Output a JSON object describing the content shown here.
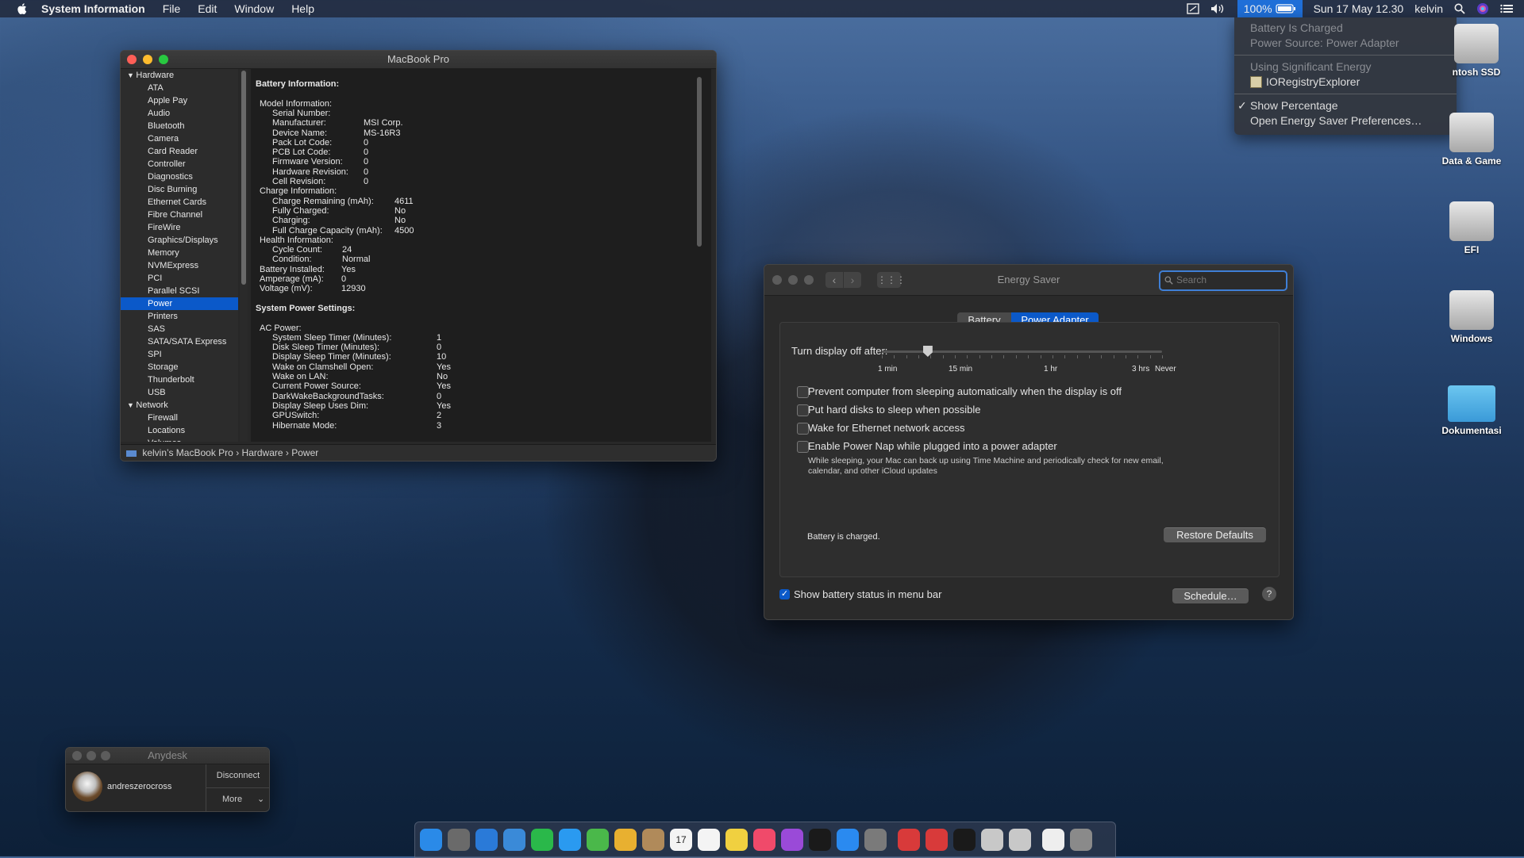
{
  "menubar": {
    "app_name": "System Information",
    "menus": [
      "File",
      "Edit",
      "Window",
      "Help"
    ],
    "battery_percent": "100%",
    "datetime": "Sun 17 May  12.30",
    "user": "kelvin"
  },
  "battery_menu": {
    "charged": "Battery Is Charged",
    "source": "Power Source: Power Adapter",
    "sig_header": "Using Significant Energy",
    "sig_app": "IORegistryExplorer",
    "show_pct": "Show Percentage",
    "open_prefs": "Open Energy Saver Preferences…"
  },
  "sysinfo": {
    "title": "MacBook Pro",
    "sidebar": [
      {
        "label": "Hardware",
        "group": true
      },
      {
        "label": "ATA"
      },
      {
        "label": "Apple Pay"
      },
      {
        "label": "Audio"
      },
      {
        "label": "Bluetooth"
      },
      {
        "label": "Camera"
      },
      {
        "label": "Card Reader"
      },
      {
        "label": "Controller"
      },
      {
        "label": "Diagnostics"
      },
      {
        "label": "Disc Burning"
      },
      {
        "label": "Ethernet Cards"
      },
      {
        "label": "Fibre Channel"
      },
      {
        "label": "FireWire"
      },
      {
        "label": "Graphics/Displays"
      },
      {
        "label": "Memory"
      },
      {
        "label": "NVMExpress"
      },
      {
        "label": "PCI"
      },
      {
        "label": "Parallel SCSI"
      },
      {
        "label": "Power",
        "selected": true
      },
      {
        "label": "Printers"
      },
      {
        "label": "SAS"
      },
      {
        "label": "SATA/SATA Express"
      },
      {
        "label": "SPI"
      },
      {
        "label": "Storage"
      },
      {
        "label": "Thunderbolt"
      },
      {
        "label": "USB"
      },
      {
        "label": "Network",
        "group": true
      },
      {
        "label": "Firewall"
      },
      {
        "label": "Locations"
      },
      {
        "label": "Volumes"
      }
    ],
    "content": [
      {
        "t": "Battery Information:",
        "lvl": 0,
        "bold": true
      },
      {
        "t": "",
        "lvl": 0
      },
      {
        "t": "Model Information:",
        "lvl": 1
      },
      {
        "t": "Serial Number:",
        "lvl": 2
      },
      {
        "t": "Manufacturer:",
        "lvl": 2,
        "v": "MSI Corp.",
        "vx": 1
      },
      {
        "t": "Device Name:",
        "lvl": 2,
        "v": "MS-16R3",
        "vx": 1
      },
      {
        "t": "Pack Lot Code:",
        "lvl": 2,
        "v": "0",
        "vx": 1
      },
      {
        "t": "PCB Lot Code:",
        "lvl": 2,
        "v": "0",
        "vx": 1
      },
      {
        "t": "Firmware Version:",
        "lvl": 2,
        "v": "0",
        "vx": 1
      },
      {
        "t": "Hardware Revision:",
        "lvl": 2,
        "v": "0",
        "vx": 1
      },
      {
        "t": "Cell Revision:",
        "lvl": 2,
        "v": "0",
        "vx": 1
      },
      {
        "t": "Charge Information:",
        "lvl": 1
      },
      {
        "t": "Charge Remaining (mAh):",
        "lvl": 2,
        "v": "4611",
        "vx": 2
      },
      {
        "t": "Fully Charged:",
        "lvl": 2,
        "v": "No",
        "vx": 2
      },
      {
        "t": "Charging:",
        "lvl": 2,
        "v": "No",
        "vx": 2
      },
      {
        "t": "Full Charge Capacity (mAh):",
        "lvl": 2,
        "v": "4500",
        "vx": 2
      },
      {
        "t": "Health Information:",
        "lvl": 1
      },
      {
        "t": "Cycle Count:",
        "lvl": 2,
        "v": "24",
        "vx": 3
      },
      {
        "t": "Condition:",
        "lvl": 2,
        "v": "Normal",
        "vx": 3
      },
      {
        "t": "Battery Installed:",
        "lvl": 1,
        "v": "Yes",
        "vx": 4
      },
      {
        "t": "Amperage (mA):",
        "lvl": 1,
        "v": "0",
        "vx": 4
      },
      {
        "t": "Voltage (mV):",
        "lvl": 1,
        "v": "12930",
        "vx": 4
      },
      {
        "t": "",
        "lvl": 0
      },
      {
        "t": "System Power Settings:",
        "lvl": 0,
        "bold": true
      },
      {
        "t": "",
        "lvl": 0
      },
      {
        "t": "AC Power:",
        "lvl": 1
      },
      {
        "t": "System Sleep Timer (Minutes):",
        "lvl": 2,
        "v": "1",
        "vx": 5
      },
      {
        "t": "Disk Sleep Timer (Minutes):",
        "lvl": 2,
        "v": "0",
        "vx": 5
      },
      {
        "t": "Display Sleep Timer (Minutes):",
        "lvl": 2,
        "v": "10",
        "vx": 5
      },
      {
        "t": "Wake on Clamshell Open:",
        "lvl": 2,
        "v": "Yes",
        "vx": 5
      },
      {
        "t": "Wake on LAN:",
        "lvl": 2,
        "v": "No",
        "vx": 5
      },
      {
        "t": "Current Power Source:",
        "lvl": 2,
        "v": "Yes",
        "vx": 5
      },
      {
        "t": "DarkWakeBackgroundTasks:",
        "lvl": 2,
        "v": "0",
        "vx": 5
      },
      {
        "t": "Display Sleep Uses Dim:",
        "lvl": 2,
        "v": "Yes",
        "vx": 5
      },
      {
        "t": "GPUSwitch:",
        "lvl": 2,
        "v": "2",
        "vx": 5
      },
      {
        "t": "Hibernate Mode:",
        "lvl": 2,
        "v": "3",
        "vx": 5
      }
    ],
    "path": [
      "kelvin’s MacBook Pro",
      "Hardware",
      "Power"
    ]
  },
  "energy": {
    "title": "Energy Saver",
    "search_placeholder": "Search",
    "tabs": [
      "Battery",
      "Power Adapter"
    ],
    "active_tab": 1,
    "slider_label": "Turn display off after:",
    "slider_value_minutes": 10,
    "ticks": [
      "1 min",
      "15 min",
      "1 hr",
      "3 hrs",
      "Never"
    ],
    "options": [
      "Prevent computer from sleeping automatically when the display is off",
      "Put hard disks to sleep when possible",
      "Wake for Ethernet network access",
      "Enable Power Nap while plugged into a power adapter"
    ],
    "powernap_desc_1": "While sleeping, your Mac can back up using Time Machine and periodically check for new email,",
    "powernap_desc_2": "calendar, and other iCloud updates",
    "status": "Battery is charged.",
    "restore": "Restore Defaults",
    "show_battery": "Show battery status in menu bar",
    "schedule": "Schedule…",
    "help": "?"
  },
  "anydesk": {
    "title": "Anydesk",
    "user": "andreszerocross",
    "disconnect": "Disconnect",
    "more": "More"
  },
  "desktop": [
    {
      "label": "ntosh SSD"
    },
    {
      "label": "Data & Game"
    },
    {
      "label": "EFI"
    },
    {
      "label": "Windows"
    },
    {
      "label": "Dokumentasi"
    }
  ],
  "dock": {
    "calendar_day": "17",
    "apps": [
      "finder-icon",
      "launchpad-icon",
      "safari-icon",
      "mail-icon",
      "facetime-icon",
      "messages-icon",
      "maps-icon",
      "photos-icon",
      "contacts-icon",
      "calendar-icon",
      "reminders-icon",
      "notes-icon",
      "music-icon",
      "podcasts-icon",
      "tv-icon",
      "appstore-icon",
      "syspref-icon",
      "anydesk-icon",
      "anydesk2-icon",
      "terminal-icon",
      "preview-icon",
      "ioreg-icon",
      "document-icon",
      "trash-icon"
    ]
  },
  "colors": {
    "accent": "#0b59c9",
    "menu_highlight": "#1f6fd8"
  }
}
